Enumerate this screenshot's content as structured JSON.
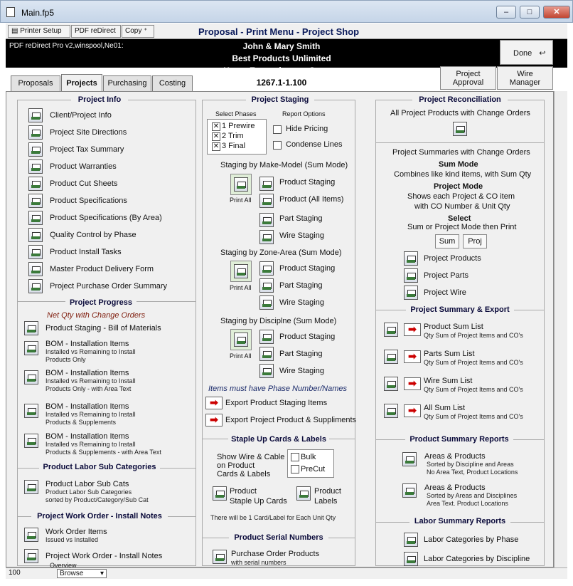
{
  "window": {
    "title": "Main.fp5",
    "minimize": "–",
    "maximize": "□",
    "close": "✕"
  },
  "toolbar": {
    "printer_setup": "Printer Setup",
    "pdf_redirect": "PDF reDirect",
    "copy": "Copy",
    "menu_title": "Proposal - Print Menu - Project Shop"
  },
  "header": {
    "pdf_info": "PDF reDirect Pro v2,winspool,Ne01:",
    "client": "John & Mary Smith",
    "company": "Best Products Unlimited",
    "project": "Home Entertainment System",
    "number": "1267.1-1.100",
    "done": "Done"
  },
  "tabs": [
    "Proposals",
    "Projects",
    "Purchasing",
    "Costing"
  ],
  "approval": {
    "project_approval": [
      "Project",
      "Approval"
    ],
    "wire_manager": [
      "Wire",
      "Manager"
    ]
  },
  "project_info": {
    "title": "Project Info",
    "items": [
      "Client/Project Info",
      "Project Site Directions",
      "Project Tax Summary",
      "Product Warranties",
      "Product Cut Sheets",
      "Product Specifications",
      "Product Specifications (By Area)",
      "Quality Control by Phase",
      "Product Install Tasks",
      "Master Product Delivery Form",
      "Project Purchase Order Summary"
    ]
  },
  "progress": {
    "title": "Project Progress",
    "subtitle": "Net Qty with Change Orders",
    "staging": "Product Staging - Bill of Materials",
    "bom": [
      {
        "t": "BOM - Installation Items",
        "l": [
          "Installed vs Remaining to Install",
          "Products Only"
        ]
      },
      {
        "t": "BOM - Installation Items",
        "l": [
          "Installed vs Remaining to Install",
          "Products Only - with Area Text"
        ]
      },
      {
        "t": "BOM - Installation Items",
        "l": [
          "Installed vs Remaining to Install",
          "Products & Supplements"
        ]
      },
      {
        "t": "BOM - Installation Items",
        "l": [
          "Installed vs Remaining to Install",
          "Products & Supplements - with Area Text"
        ]
      }
    ]
  },
  "labor_sub": {
    "title": "Product Labor Sub Categories",
    "item": "Product Labor Sub Cats",
    "l1": "Product Labor Sub Categories",
    "l2": "sorted by Product/Category/Sub Cat"
  },
  "work_order": {
    "title": "Project Work Order - Install Notes",
    "i1": "Work Order Items",
    "i1s": "Issued vs Installed",
    "i2": "Project Work Order - Install Notes",
    "i2s": "Overview"
  },
  "staging": {
    "title": "Project Staging",
    "select_phases": "Select Phases",
    "phases": [
      "1 Prewire",
      "2 Trim",
      "3 Final"
    ],
    "report_options": "Report Options",
    "hide_pricing": "Hide Pricing",
    "condense": "Condense Lines",
    "mm_title": "Staging by Make-Model (Sum Mode)",
    "print_all": "Print All",
    "mm_items": [
      "Product Staging",
      "Product (All Items)",
      "Part Staging",
      "Wire Staging"
    ],
    "za_title": "Staging by Zone-Area (Sum Mode)",
    "za_items": [
      "Product Staging",
      "Part Staging",
      "Wire Staging"
    ],
    "dp_title": "Staging by Disciplne (Sum Mode)",
    "dp_items": [
      "Product Staging",
      "Part Staging",
      "Wire Staging"
    ],
    "note": "Items must have Phase Number/Names",
    "export1": "Export Product Staging Items",
    "export2": "Export Project Product & Suppliments"
  },
  "staple": {
    "title": "Staple Up Cards & Labels",
    "show": [
      "Show Wire & Cable",
      "on Product",
      "Cards & Labels"
    ],
    "bulk": "Bulk",
    "precut": "PreCut",
    "cards": [
      "Product",
      "Staple Up Cards"
    ],
    "labels": [
      "Product",
      "Labels"
    ],
    "note": "There will be 1 Card/Label for Each Unit Qty"
  },
  "serial": {
    "title": "Product Serial Numbers",
    "item": "Purchase Order Products",
    "sub": "with serial numbers"
  },
  "reconciliation": {
    "title": "Project Reconciliation",
    "all": "All Project Products with Change Orders",
    "summaries": "Project Summaries with Change Orders",
    "sum_mode": "Sum Mode",
    "sum_desc": "Combines like kind items, with Sum Qty",
    "proj_mode": "Project Mode",
    "proj_desc1": "Shows each Project & CO item",
    "proj_desc2": "with CO Number & Unit Qty",
    "select": "Select",
    "select_desc": "Sum or Project Mode then Print",
    "sum_btn": "Sum",
    "proj_btn": "Proj",
    "items": [
      "Project Products",
      "Project Parts",
      "Project Wire"
    ]
  },
  "summary_export": {
    "title": "Project Summary & Export",
    "items": [
      {
        "t": "Product Sum List",
        "s": "Qty Sum of Project Items and CO's"
      },
      {
        "t": "Parts Sum List",
        "s": "Qty Sum of Project Items and CO's"
      },
      {
        "t": "Wire Sum List",
        "s": "Qty Sum of Project Items and CO's"
      },
      {
        "t": "All Sum List",
        "s": "Qty Sum of Project Items and CO's"
      }
    ]
  },
  "product_summary": {
    "title": "Product Summary Reports",
    "items": [
      {
        "t": "Areas & Products",
        "l": [
          "Sorted by Discipline and Areas",
          "No Area Text, Product Locations"
        ]
      },
      {
        "t": "Areas & Products",
        "l": [
          "Sorted by Areas and Disciplines",
          "Area Text. Product Locations"
        ]
      }
    ]
  },
  "labor_summary": {
    "title": "Labor Summary Reports",
    "items": [
      "Labor Categories by Phase",
      "Labor Categories by Discipline"
    ]
  },
  "status": {
    "zoom": "100",
    "mode": "Browse"
  }
}
